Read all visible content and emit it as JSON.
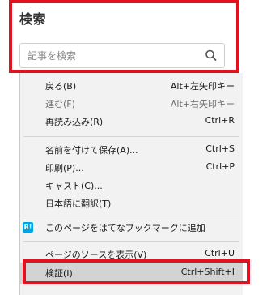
{
  "search": {
    "title": "検索",
    "placeholder": "記事を検索"
  },
  "menu": {
    "items": [
      {
        "label": "戻る(B)",
        "shortcut": "Alt+左矢印キー"
      },
      {
        "label": "進む(F)",
        "shortcut": "Alt+右矢印キー"
      },
      {
        "label": "再読み込み(R)",
        "shortcut": "Ctrl+R"
      },
      {
        "label": "名前を付けて保存(A)...",
        "shortcut": "Ctrl+S"
      },
      {
        "label": "印刷(P)...",
        "shortcut": "Ctrl+P"
      },
      {
        "label": "キャスト(C)..."
      },
      {
        "label": "日本語に翻訳(T)"
      },
      {
        "label": "このページをはてなブックマークに追加",
        "icon_text": "B!"
      },
      {
        "label": "ページのソースを表示(V)",
        "shortcut": "Ctrl+U"
      },
      {
        "label": "検証(I)",
        "shortcut": "Ctrl+Shift+I"
      }
    ]
  },
  "colors": {
    "highlight_border": "#e1111e",
    "hatena_icon": "#00a4de"
  }
}
